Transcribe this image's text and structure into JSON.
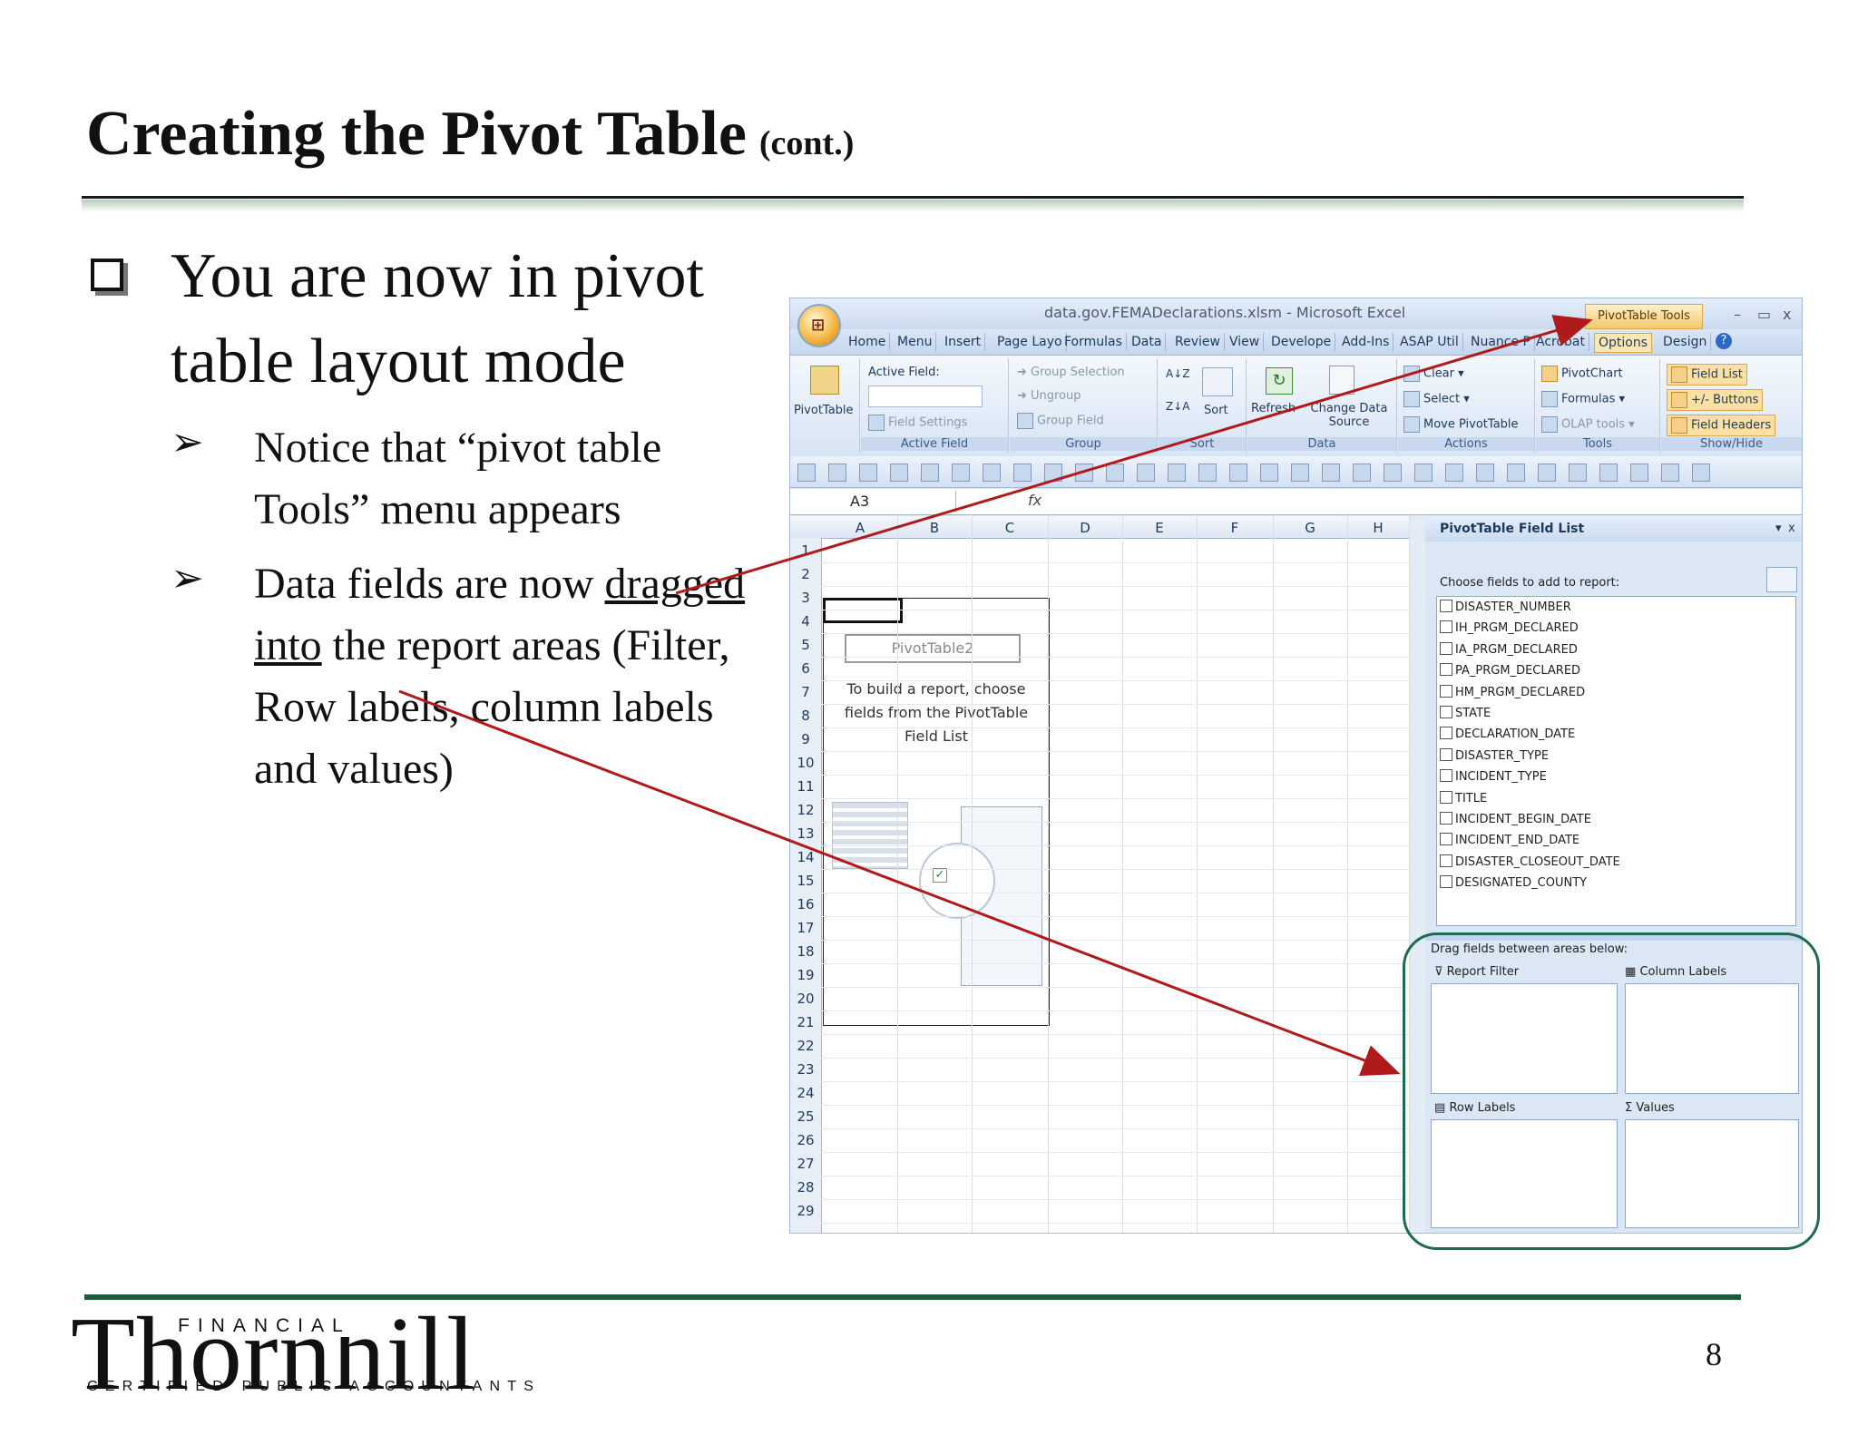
{
  "slide": {
    "title": "Creating the Pivot Table",
    "title_suffix": "(cont.)",
    "bullet_main": "You are now in pivot table layout mode",
    "sub_bullets": [
      {
        "text": "Notice that “pivot table Tools” menu appears"
      },
      {
        "pre": "Data fields are now ",
        "underlined": "dragged into",
        "post": " the report areas (Filter, Row labels, column labels and values)"
      }
    ],
    "page_number": "8",
    "colors": {
      "footer_rule": "#1c5c3c",
      "arrow": "#b01a1a",
      "highlight_ring": "#1e6a50"
    }
  },
  "logo": {
    "main": "Thornhill",
    "top": "FINANCIAL",
    "bottom": "CERTIFIED PUBLIC ACCOUNTANTS"
  },
  "excel": {
    "window_title": "data.gov.FEMADeclarations.xlsm - Microsoft Excel",
    "contextual_tab": "PivotTable Tools",
    "window_controls": [
      "–",
      "▭",
      "x"
    ],
    "tabs": [
      "Home",
      "Menu",
      "Insert",
      "Page Layo",
      "Formulas",
      "Data",
      "Review",
      "View",
      "Develope",
      "Add-Ins",
      "ASAP Util",
      "Nuance P",
      "Acrobat",
      "Options",
      "Design"
    ],
    "active_tab": "Options",
    "ribbon": {
      "pivottable_btn": "PivotTable",
      "active_field": "Active Field:",
      "field_settings": "Field Settings",
      "active_field_group": "Active Field",
      "group_selection": "Group Selection",
      "ungroup": "Ungroup",
      "group_field": "Group Field",
      "group_group": "Group",
      "sort_btn": "Sort",
      "sort_group": "Sort",
      "refresh": "Refresh",
      "change_source": "Change Data Source",
      "data_group": "Data",
      "clear": "Clear",
      "select": "Select",
      "move_pivot": "Move PivotTable",
      "actions_group": "Actions",
      "pivotchart": "PivotChart",
      "formulas": "Formulas",
      "olap": "OLAP tools",
      "tools_group": "Tools",
      "field_list": "Field List",
      "buttons": "+/- Buttons",
      "field_headers": "Field Headers",
      "showhide_group": "Show/Hide"
    },
    "name_box": "A3",
    "fx": "fx",
    "columns": [
      "A",
      "B",
      "C",
      "D",
      "E",
      "F",
      "G",
      "H"
    ],
    "rows": [
      "1",
      "2",
      "3",
      "4",
      "5",
      "6",
      "7",
      "8",
      "9",
      "10",
      "11",
      "12",
      "13",
      "14",
      "15",
      "16",
      "17",
      "18",
      "19",
      "20",
      "21",
      "22",
      "23",
      "24",
      "25",
      "26",
      "27",
      "28",
      "29"
    ],
    "pivot_name": "PivotTable2",
    "pivot_help": "To build a report, choose fields from the PivotTable Field List",
    "field_list": {
      "title": "PivotTable Field List",
      "choose": "Choose fields to add to report:",
      "fields": [
        "DISASTER_NUMBER",
        "IH_PRGM_DECLARED",
        "IA_PRGM_DECLARED",
        "PA_PRGM_DECLARED",
        "HM_PRGM_DECLARED",
        "STATE",
        "DECLARATION_DATE",
        "DISASTER_TYPE",
        "INCIDENT_TYPE",
        "TITLE",
        "INCIDENT_BEGIN_DATE",
        "INCIDENT_END_DATE",
        "DISASTER_CLOSEOUT_DATE",
        "DESIGNATED_COUNTY"
      ],
      "drag_label": "Drag fields between areas below:",
      "report_filter": "Report Filter",
      "column_labels": "Column Labels",
      "row_labels": "Row Labels",
      "values": "Values"
    }
  }
}
